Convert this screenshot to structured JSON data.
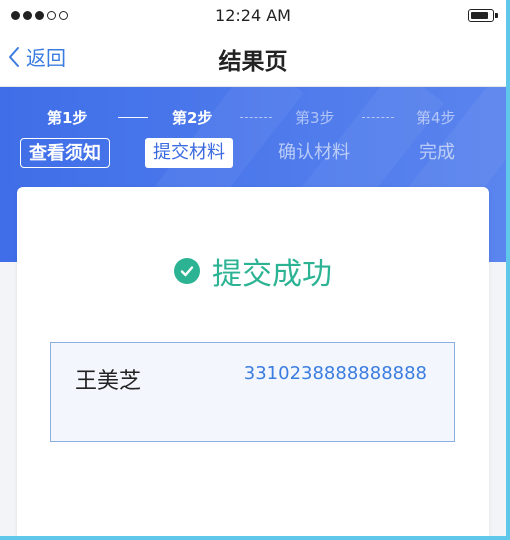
{
  "status_bar": {
    "time": "12:24 AM",
    "signal_dots_filled": 3,
    "signal_dots_total": 5
  },
  "nav": {
    "back_label": "返回",
    "title": "结果页"
  },
  "steps": [
    {
      "number": "第1步",
      "label": "查看须知",
      "state": "done"
    },
    {
      "number": "第2步",
      "label": "提交材料",
      "state": "active"
    },
    {
      "number": "第3步",
      "label": "确认材料",
      "state": "pending"
    },
    {
      "number": "第4步",
      "label": "完成",
      "state": "pending"
    }
  ],
  "result": {
    "message": "提交成功",
    "name": "王美芝",
    "id_number": "3310238888888888"
  },
  "colors": {
    "primary": "#3f6ee8",
    "accent_blue": "#3b7ce0",
    "success": "#2cb394",
    "frame_border": "#5fc7ea"
  },
  "icons": {
    "back": "chevron-left-icon",
    "success": "check-circle-icon",
    "battery": "battery-icon"
  }
}
